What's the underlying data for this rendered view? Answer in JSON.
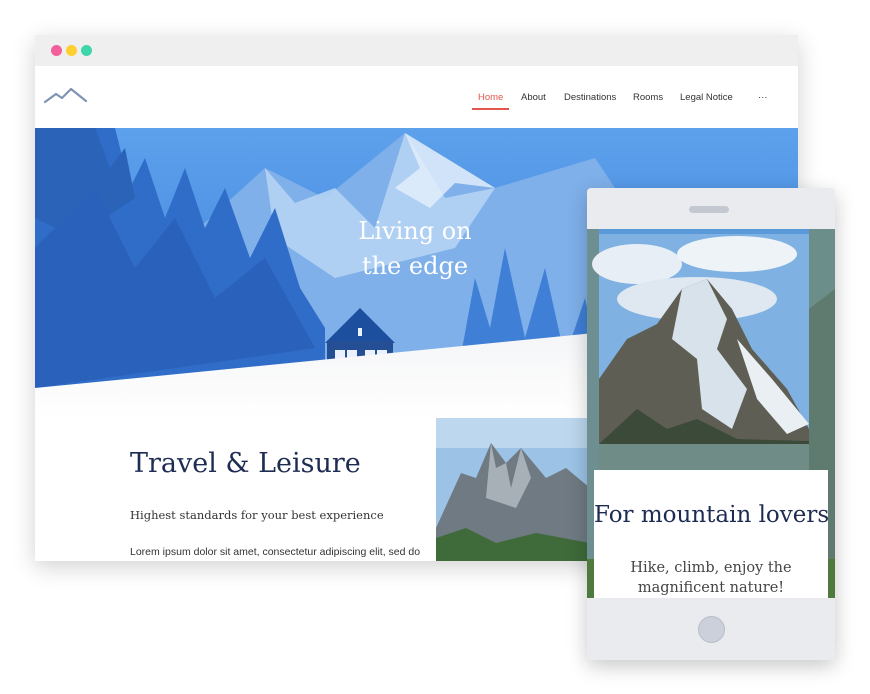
{
  "nav": {
    "items": [
      {
        "label": "Home",
        "active": true
      },
      {
        "label": "About",
        "active": false
      },
      {
        "label": "Destinations",
        "active": false
      },
      {
        "label": "Rooms",
        "active": false
      },
      {
        "label": "Legal Notice",
        "active": false
      },
      {
        "label": "···",
        "active": false
      }
    ]
  },
  "hero": {
    "line1": "Living on",
    "line2": "the edge"
  },
  "section": {
    "title": "Travel & Leisure",
    "subtitle": "Highest standards for your best experience",
    "body": "Lorem ipsum dolor sit amet, consectetur adipiscing elit, sed do"
  },
  "mobile": {
    "title": "For mountain lovers",
    "text": "Hike, climb, enjoy the magnificent nature!"
  },
  "colors": {
    "accent": "#e2574c",
    "heading": "#1e2b52",
    "hero_blue": "#3b7fdc"
  },
  "icons": {
    "logo": "mountain-logo-icon",
    "window_controls": [
      "close-dot",
      "minimize-dot",
      "maximize-dot"
    ],
    "home_button": "home-button"
  }
}
